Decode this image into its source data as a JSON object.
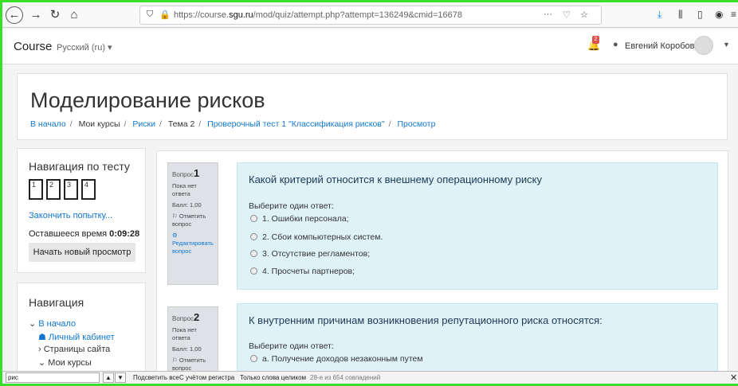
{
  "browser": {
    "url_plain": "https://course.",
    "url_domain": "sgu.ru",
    "url_rest": "/mod/quiz/attempt.php?attempt=136249&cmid=16678",
    "url_more": "···"
  },
  "topnav": {
    "brand": "Course",
    "language": "Русский (ru) ▾",
    "notification_count": "2",
    "user_name": "Евгений Коробов"
  },
  "header": {
    "title": "Моделирование рисков",
    "breadcrumb": [
      "В начало",
      "Мои курсы",
      "Риски",
      "Тема 2",
      "Проверочный тест 1 \"Классификация рисков\"",
      "Просмотр"
    ]
  },
  "quiz_nav": {
    "title": "Навигация по тесту",
    "question_numbers": [
      "1",
      "2",
      "3",
      "4"
    ],
    "finish_link": "Закончить попытку...",
    "time_label": "Оставшееся время",
    "time_value": "0:09:28",
    "new_preview_button": "Начать новый просмотр"
  },
  "navigation": {
    "title": "Навигация",
    "items": [
      "В начало",
      "Личный кабинет",
      "Страницы сайта",
      "Мои курсы"
    ]
  },
  "questions": [
    {
      "label": "Вопрос",
      "number": "1",
      "status": "Пока нет ответа",
      "score": "Балл: 1,00",
      "flag": "Отметить вопрос",
      "edit": "Редактировать вопрос",
      "text": "Какой критерий относится к внешнему операционному риску",
      "prompt": "Выберите один ответ:",
      "options": [
        "1. Ошибки персонала;",
        "2. Сбои компьютерных систем.",
        "3. Отсутствие регламентов;",
        "4. Просчеты партнеров;"
      ]
    },
    {
      "label": "Вопрос",
      "number": "2",
      "status": "Пока нет ответа",
      "score": "Балл: 1,00",
      "flag": "Отметить вопрос",
      "text": "К внутренним причинам возникновения репутационного риска относятся:",
      "prompt": "Выберите один ответ:",
      "options": [
        "a. Получение доходов незаконным путем"
      ]
    }
  ],
  "findbar": {
    "query": "рис",
    "highlight_all": "Подсветить все",
    "match_case": "С учётом регистра",
    "whole_words": "Только слова целиком",
    "matches": "28-е из 654 совпадений"
  }
}
